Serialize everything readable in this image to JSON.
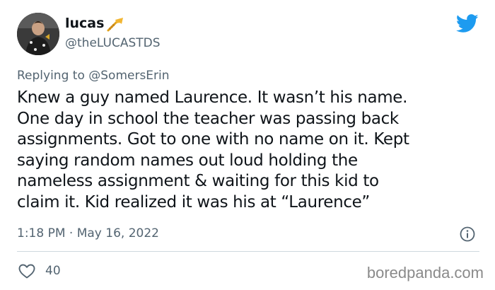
{
  "author": {
    "display_name": "lucas",
    "handle": "@theLUCASTDS",
    "emoji_icon": "trumpet-icon"
  },
  "reply": {
    "prefix": "Replying to",
    "mention": "@SomersErin"
  },
  "tweet": {
    "lines": [
      "Knew a guy named Laurence. It wasn’t his name.",
      "One day in school the teacher was passing back",
      "assignments. Got to one with no name on it. Kept",
      "saying random names out loud holding the",
      "nameless assignment & waiting for this kid to",
      "claim it. Kid realized it was his at “Laurence”"
    ],
    "timestamp": "1:18 PM · May 16, 2022"
  },
  "stats": {
    "likes": "40"
  },
  "watermark": "boredpanda.com",
  "colors": {
    "twitter_blue": "#1d9bf0",
    "secondary_text": "#536471",
    "primary_text": "#0f1419"
  }
}
